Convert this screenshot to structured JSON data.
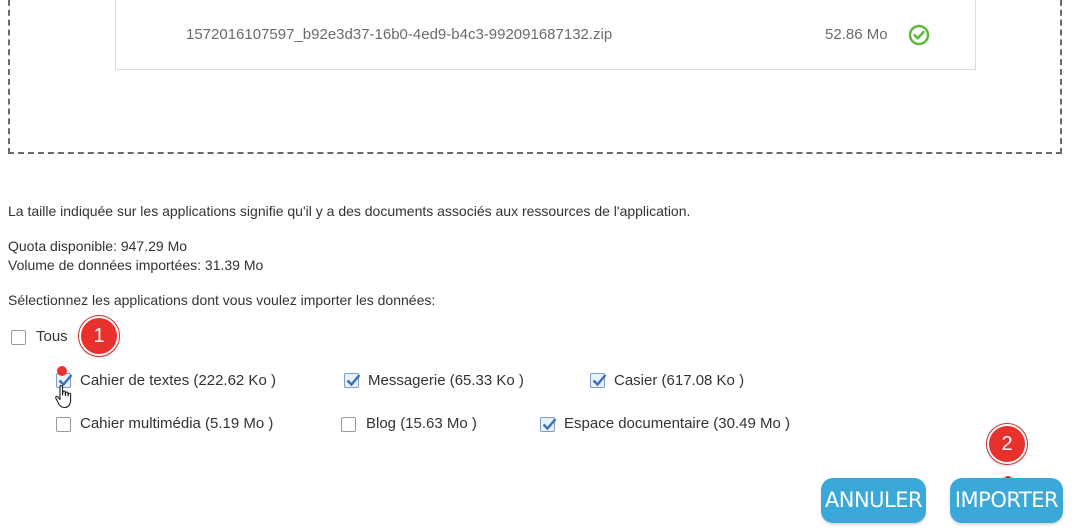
{
  "upload": {
    "file_name": "1572016107597_b92e3d37-16b0-4ed9-b4c3-992091687132.zip",
    "file_size": "52.86 Mo",
    "status_icon": "check-circle-icon",
    "status_color": "#5cb93c"
  },
  "info": {
    "size_note": "La taille indiquée sur les applications signifie qu'il y a des documents associés aux ressources de l'application.",
    "quota": "Quota disponible: 947.29 Mo",
    "imported_volume": "Volume de données importées: 31.39 Mo",
    "select_prompt": "Sélectionnez les applications dont vous voulez importer les données:"
  },
  "select_all": {
    "label": "Tous",
    "checked": false
  },
  "apps": [
    {
      "label": "Cahier de textes  (222.62  Ko )",
      "checked": true
    },
    {
      "label": "Messagerie  (65.33  Ko )",
      "checked": true
    },
    {
      "label": "Casier  (617.08  Ko )",
      "checked": true
    },
    {
      "label": "Cahier multimédia  (5.19  Mo )",
      "checked": false
    },
    {
      "label": "Blog  (15.63  Mo )",
      "checked": false
    },
    {
      "label": "Espace documentaire  (30.49  Mo )",
      "checked": true
    }
  ],
  "buttons": {
    "cancel": "ANNULER",
    "import": "IMPORTER"
  },
  "annotations": {
    "step1": "1",
    "step2": "2"
  },
  "colors": {
    "accent": "#3aa8d8",
    "marker": "#e8302c",
    "check": "#3b6fb6"
  }
}
